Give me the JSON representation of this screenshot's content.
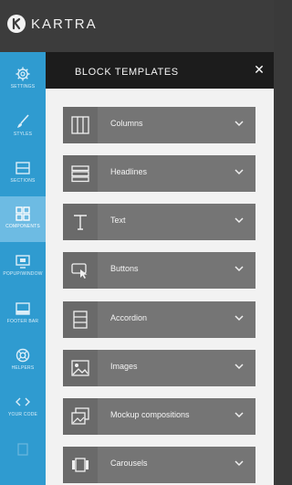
{
  "app": {
    "brand": "KARTRA"
  },
  "sidebar": {
    "items": [
      {
        "label": "Settings",
        "icon": "gear-icon"
      },
      {
        "label": "Styles",
        "icon": "brush-icon"
      },
      {
        "label": "Sections",
        "icon": "sections-icon"
      },
      {
        "label": "Components",
        "icon": "components-icon",
        "active": true
      },
      {
        "label": "Popup/window",
        "icon": "popup-icon"
      },
      {
        "label": "Footer bar",
        "icon": "footer-bar-icon"
      },
      {
        "label": "Helpers",
        "icon": "helpers-icon"
      },
      {
        "label": "Your code",
        "icon": "code-icon"
      },
      {
        "label": "",
        "icon": "faded-icon"
      }
    ]
  },
  "panel": {
    "title": "BLOCK TEMPLATES",
    "close": "✕",
    "templates": [
      {
        "label": "Columns",
        "icon": "columns-icon"
      },
      {
        "label": "Headlines",
        "icon": "headlines-icon"
      },
      {
        "label": "Text",
        "icon": "text-icon"
      },
      {
        "label": "Buttons",
        "icon": "buttons-icon"
      },
      {
        "label": "Accordion",
        "icon": "accordion-icon"
      },
      {
        "label": "Images",
        "icon": "images-icon"
      },
      {
        "label": "Mockup compositions",
        "icon": "mockup-icon"
      },
      {
        "label": "Carousels",
        "icon": "carousel-icon"
      }
    ]
  },
  "colors": {
    "sidebar": "#2f9bd0",
    "sidebar_active": "#6dbbe3",
    "header": "#1c1c1c",
    "row": "#757575",
    "panel_bg": "#f2f2f2"
  }
}
